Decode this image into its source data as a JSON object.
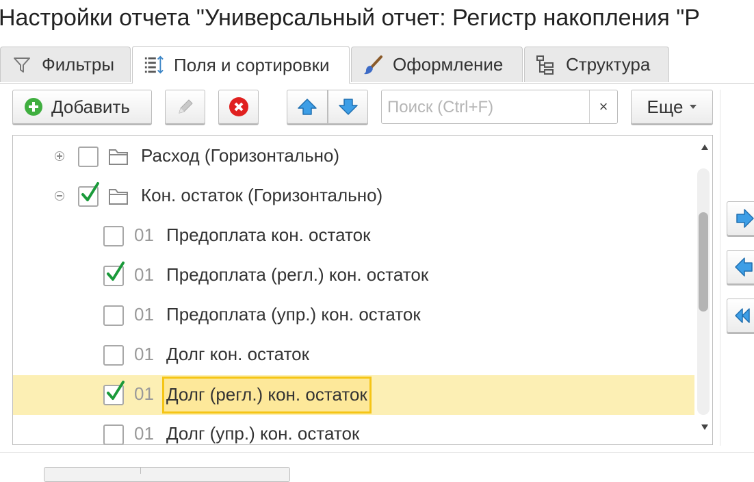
{
  "window": {
    "title": "Настройки отчета \"Универсальный отчет: Регистр накопления \"Р"
  },
  "tabs": [
    {
      "label": "Фильтры",
      "icon": "filter-icon",
      "active": false
    },
    {
      "label": "Поля и сортировки",
      "icon": "fields-sort-icon",
      "active": true
    },
    {
      "label": "Оформление",
      "icon": "brush-icon",
      "active": false
    },
    {
      "label": "Структура",
      "icon": "structure-icon",
      "active": false
    }
  ],
  "toolbar": {
    "add_label": "Добавить",
    "more_label": "Еще",
    "search_placeholder": "Поиск (Ctrl+F)",
    "search_value": "",
    "clear_symbol": "×"
  },
  "tree": {
    "rows": [
      {
        "type": "group",
        "label": "Расход (Горизонтально)",
        "checked": false,
        "expanded": false,
        "selected": false
      },
      {
        "type": "group",
        "label": "Кон. остаток (Горизонтально)",
        "checked": true,
        "expanded": true,
        "selected": false
      },
      {
        "type": "field",
        "code": "01",
        "label": "Предоплата кон. остаток",
        "checked": false,
        "selected": false
      },
      {
        "type": "field",
        "code": "01",
        "label": "Предоплата (регл.) кон. остаток",
        "checked": true,
        "selected": false
      },
      {
        "type": "field",
        "code": "01",
        "label": "Предоплата (упр.) кон. остаток",
        "checked": false,
        "selected": false
      },
      {
        "type": "field",
        "code": "01",
        "label": "Долг кон. остаток",
        "checked": false,
        "selected": false
      },
      {
        "type": "field",
        "code": "01",
        "label": "Долг (регл.) кон. остаток",
        "checked": true,
        "selected": true
      },
      {
        "type": "field",
        "code": "01",
        "label": "Долг (упр.) кон. остаток",
        "checked": false,
        "selected": false
      }
    ]
  },
  "colors": {
    "accent_blue": "#3d9ee6",
    "check_green": "#1a9a3a",
    "selection": "#fcefb4",
    "focus_border": "#f5c516",
    "delete_red": "#e0201f",
    "add_green": "#3fae3f"
  }
}
